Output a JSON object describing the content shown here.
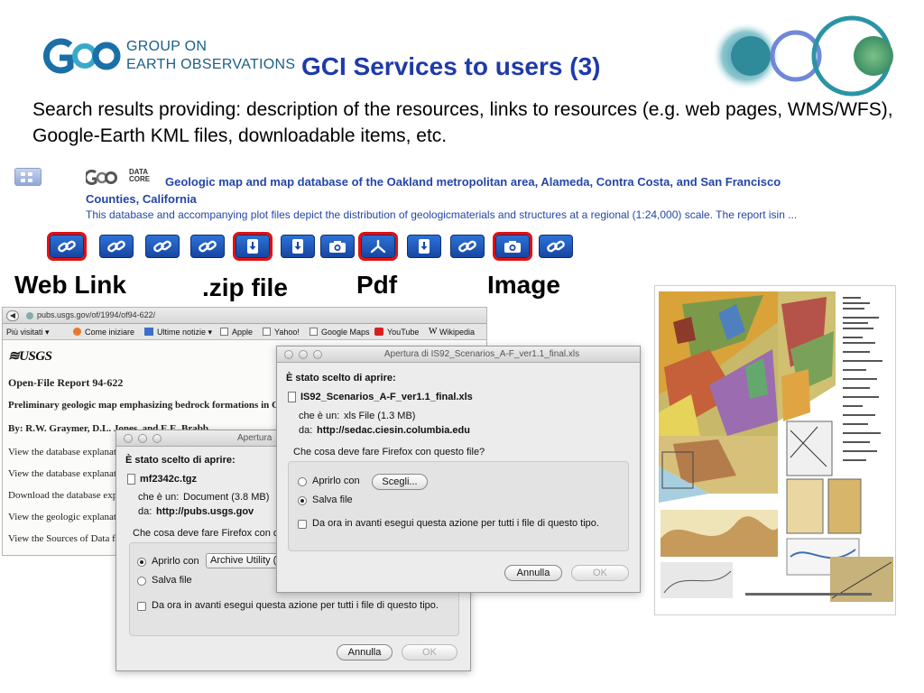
{
  "header": {
    "logo_line1": "GROUP ON",
    "logo_line2": "EARTH OBSERVATIONS",
    "title": "GCI Services to users (3)"
  },
  "intro": "Search results providing: description of the resources, links to resources (e.g. web pages, WMS/WFS), Google-Earth KML files, downloadable items, etc.",
  "result": {
    "data_core_line1": "DATA",
    "data_core_line2": "CORE",
    "title": "Geologic map and map database of the Oakland metropolitan area, Alameda, Contra Costa, and San Francisco Counties, California",
    "description": "This database and accompanying plot files depict the distribution of geologicmaterials and structures at a regional (1:24,000) scale. The report isin ...",
    "link_buttons": [
      {
        "icon": "link-icon",
        "highlighted": true
      },
      {
        "icon": "link-icon",
        "highlighted": false
      },
      {
        "icon": "link-icon",
        "highlighted": false
      },
      {
        "icon": "link-icon",
        "highlighted": false
      },
      {
        "icon": "download-icon",
        "highlighted": true
      },
      {
        "icon": "download-icon",
        "highlighted": false
      },
      {
        "icon": "camera-icon",
        "highlighted": false
      },
      {
        "icon": "pdf-icon",
        "highlighted": true
      },
      {
        "icon": "download-icon",
        "highlighted": false
      },
      {
        "icon": "link-icon",
        "highlighted": false
      },
      {
        "icon": "camera-icon",
        "highlighted": true
      },
      {
        "icon": "link-icon",
        "highlighted": false
      }
    ]
  },
  "captions": {
    "web_link": "Web Link",
    "zip_file": ".zip file",
    "pdf": "Pdf",
    "image": "Image"
  },
  "browser": {
    "url": "pubs.usgs.gov/of/1994/of94-622/",
    "bookmarks": [
      "Più visitati ▾",
      "Come iniziare",
      "Ultime notizie ▾",
      "Apple",
      "Yahoo!",
      "Google Maps",
      "YouTube",
      "Wikipedia"
    ],
    "usgs_logo": "≋USGS",
    "report_title": "Open-File Report 94-622",
    "report_subtitle": "Preliminary geologic map emphasizing bedrock formations in Cor",
    "authors": "By: R.W. Graymer, D.L. Jones, and E.E. Brabb",
    "lines": [
      "View the database explanati",
      "View the database explanati",
      "Download the database expl",
      "View the geologic explanati",
      "View the Sources of Data fil"
    ]
  },
  "dialog_zip": {
    "title": "Apertura",
    "chosen_label": "È stato scelto di aprire:",
    "filename": "mf2342c.tgz",
    "type_label": "che è un:",
    "type_value": "Document (3.8 MB)",
    "from_label": "da:",
    "from_value": "http://pubs.usgs.gov",
    "question": "Che cosa deve fare Firefox con q",
    "open_with_label": "Aprirlo con",
    "open_with_value": "Archive Utility (",
    "save_label": "Salva file",
    "remember_label": "Da ora in avanti esegui questa azione per tutti i file di questo tipo.",
    "cancel_label": "Annulla",
    "ok_label": "OK"
  },
  "dialog_xls": {
    "title": "Apertura di IS92_Scenarios_A-F_ver1.1_final.xls",
    "chosen_label": "È stato scelto di aprire:",
    "filename": "IS92_Scenarios_A-F_ver1.1_final.xls",
    "type_label": "che è un:",
    "type_value": "xls File (1.3 MB)",
    "from_label": "da:",
    "from_value": "http://sedac.ciesin.columbia.edu",
    "question": "Che cosa deve fare Firefox con questo file?",
    "open_with_label": "Aprirlo con",
    "choose_label": "Scegli...",
    "save_label": "Salva file",
    "remember_label": "Da ora in avanti esegui questa azione per tutti i file di questo tipo.",
    "cancel_label": "Annulla",
    "ok_label": "OK"
  }
}
